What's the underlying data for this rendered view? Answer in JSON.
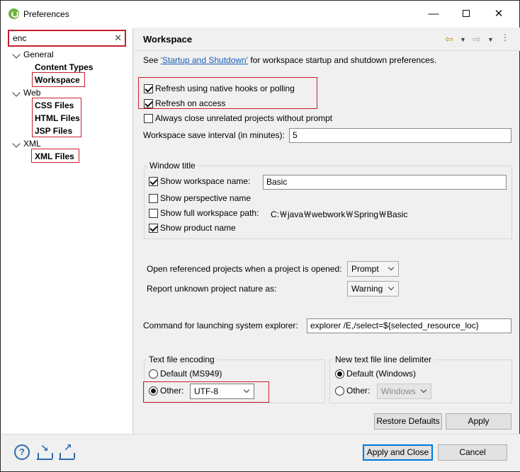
{
  "window": {
    "title": "Preferences",
    "minimize": "—",
    "close": "✕"
  },
  "filter": {
    "value": "enc",
    "clear_icon": "✕"
  },
  "tree": {
    "general": "General",
    "content_types": "Content Types",
    "workspace": "Workspace",
    "web": "Web",
    "css_files": "CSS Files",
    "html_files": "HTML Files",
    "jsp_files": "JSP Files",
    "xml": "XML",
    "xml_files": "XML Files"
  },
  "page": {
    "title": "Workspace",
    "nav": {
      "back": "⇦",
      "fwd": "⇨",
      "dropdown": "▼",
      "menu": "⋮"
    },
    "intro_prefix": "See ",
    "intro_link": "'Startup and Shutdown'",
    "intro_suffix": " for workspace startup and shutdown preferences.",
    "refresh_native": "Refresh using native hooks or polling",
    "refresh_access": "Refresh on access",
    "always_close": "Always close unrelated projects without prompt",
    "save_interval_label": "Workspace save interval (in minutes):",
    "save_interval_value": "5",
    "window_title": {
      "group_label": "Window title",
      "show_workspace_name": "Show workspace name:",
      "workspace_name_value": "Basic",
      "show_perspective_name": "Show perspective name",
      "show_full_path": "Show full workspace path:",
      "full_path_value": "C:￦java￦webwork￦Spring￦Basic",
      "show_product_name": "Show product name"
    },
    "open_referenced_label": "Open referenced projects when a project is opened:",
    "open_referenced_value": "Prompt",
    "report_unknown_label": "Report unknown project nature as:",
    "report_unknown_value": "Warning",
    "explorer_label": "Command for launching system explorer:",
    "explorer_value": "explorer /E,/select=${selected_resource_loc}",
    "encoding": {
      "group_label": "Text file encoding",
      "default": "Default (MS949)",
      "other": "Other:",
      "other_value": "UTF-8"
    },
    "delimiter": {
      "group_label": "New text file line delimiter",
      "default": "Default (Windows)",
      "other": "Other:",
      "other_value": "Windows"
    },
    "restore_defaults": "Restore Defaults",
    "apply": "Apply"
  },
  "footer": {
    "help_icon": "?",
    "apply_close": "Apply and Close",
    "cancel": "Cancel"
  },
  "colors": {
    "highlight_border": "#c6202c",
    "link": "#1a5fb4",
    "default_button_border": "#0078d7"
  }
}
